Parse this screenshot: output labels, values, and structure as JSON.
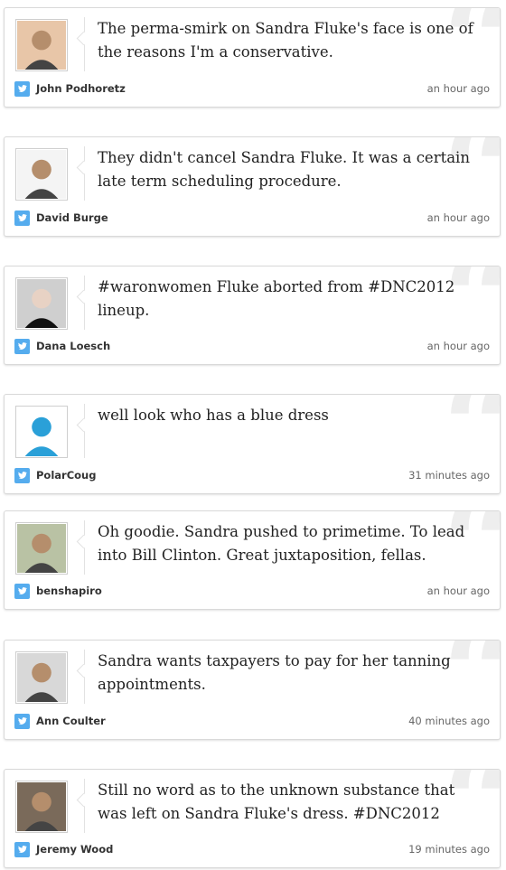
{
  "colors": {
    "twitter_blue": "#55acee",
    "quote_gray": "#eeeeee"
  },
  "tweets": [
    {
      "text": "The perma-smirk on Sandra Fluke's face is one of the reasons I'm a conservative.",
      "author": "John Podhoretz",
      "time": "an hour ago",
      "avatar_icon": "baby-photo-icon",
      "avatar_color": "#e8c6a8"
    },
    {
      "text": "They didn't cancel Sandra Fluke. It was a certain late term scheduling procedure.",
      "author": "David Burge",
      "time": "an hour ago",
      "avatar_icon": "man-with-pipe-icon",
      "avatar_color": "#f4f4f4"
    },
    {
      "text": "#waronwomen Fluke aborted from #DNC2012 lineup.",
      "author": "Dana Loesch",
      "time": "an hour ago",
      "avatar_icon": "woman-portrait-icon",
      "avatar_color": "#cfcfcf"
    },
    {
      "text": "well look who has a blue dress",
      "author": "PolarCoug",
      "time": "31 minutes ago",
      "avatar_icon": "penguin-icon",
      "avatar_color": "#ffffff"
    },
    {
      "text": "Oh goodie. Sandra pushed to primetime. To lead into Bill Clinton. Great juxtaposition, fellas.",
      "author": "benshapiro",
      "time": "an hour ago",
      "avatar_icon": "man-portrait-icon",
      "avatar_color": "#b9c2a4"
    },
    {
      "text": "Sandra wants taxpayers to pay for her tanning appointments.",
      "author": "Ann Coulter",
      "time": "40 minutes ago",
      "avatar_icon": "woman-standing-icon",
      "avatar_color": "#d8d8d8"
    },
    {
      "text": "Still no word as to the unknown substance that was left on Sandra Fluke's dress. #DNC2012",
      "author": "Jeremy Wood",
      "time": "19 minutes ago",
      "avatar_icon": "man-smiling-icon",
      "avatar_color": "#7a6a5a"
    }
  ]
}
